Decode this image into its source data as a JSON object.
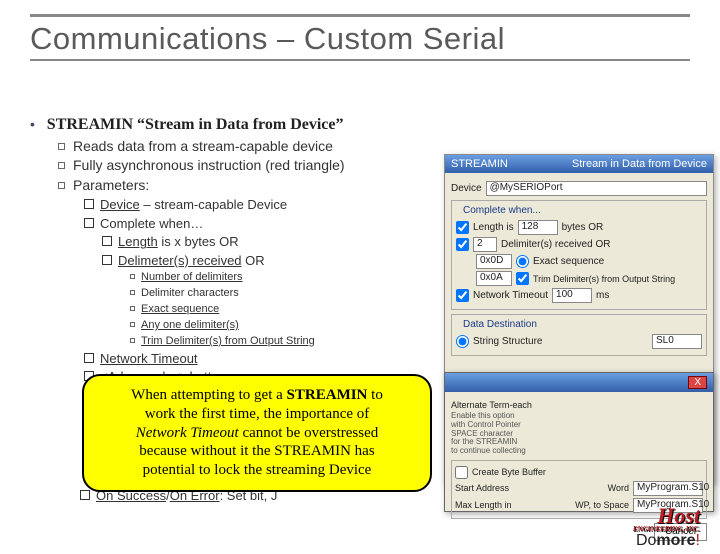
{
  "title": "Communications – Custom Serial",
  "bullet_main_prefix": "STREAMIN ",
  "bullet_main_quote": "“Stream in Data from Device”",
  "sub": {
    "a": "Reads data from a stream-capable device",
    "b": "Fully asynchronous instruction (red triangle)",
    "c": "Parameters:"
  },
  "params": {
    "device_u": "Device",
    "device_rest": " – stream-capable Device",
    "complete": "Complete when…",
    "length_u": "Length",
    "length_rest": " is x bytes OR",
    "delim_u": "Delimeter(s) received",
    "delim_rest": " OR"
  },
  "l4": {
    "a_u": "Number of delimiters",
    "b": "Delimiter characters",
    "c_u": "Exact sequence",
    "d_u": "Any one delimiter(s)",
    "e_u": "Trim Delimiter(s) from Output String"
  },
  "params2": {
    "net_u": "Network Timeout",
    "adv_pre": "",
    "adv_u": "<Advanced…>",
    "adv_rest": " button"
  },
  "callout": {
    "l1a": "When attempting to get a ",
    "l1b": "STREAMIN",
    "l1c": " to",
    "l2": "work the first time, the importance of",
    "l3a": "Network Timeout",
    "l3b": " cannot be overstressed",
    "l4": "because without it the STREAMIN has",
    "l5": "potential to lock the streaming Device"
  },
  "behind": {
    "u1": "On Success",
    "sep": "/",
    "u2": "On Error",
    "rest": ": Set bit, J"
  },
  "dialog": {
    "title_left": "STREAMIN",
    "title_right": "Stream in Data from Device",
    "device_label": "Device",
    "device_value": "@MySERIOPort",
    "complete_group": "Complete when...",
    "length_label": "Length is",
    "length_value": "128",
    "length_unit": "bytes OR",
    "delim_count": "2",
    "delim_label": "Delimiter(s) received OR",
    "hex1": "0x0D",
    "hex2": "0x0A",
    "exact": "Exact sequence",
    "trim": "Trim Delimiter(s) from Output String",
    "net_label": "Network Timeout",
    "net_value": "100",
    "net_unit": "ms",
    "dest_group": "Data Destination",
    "dest_opt": "String Structure",
    "dest_val": "SL0",
    "t1a": "Create Byte Buffer",
    "t2l": "Start Address",
    "t2r": "Word",
    "t3l": "Max Length in",
    "t3r": "WP, to Space",
    "t2v": "MyProgram.S10",
    "t3v": "MyProgram.S10",
    "cancel": "Cancel"
  },
  "sub_dialog": {
    "text1": "Alternate Term-each",
    "text2": "Enable this option",
    "text3": "with Control Pointer",
    "text4": "SPACE character",
    "text5": "for the STREAMIN",
    "text6": "to continue collecting"
  },
  "logo": {
    "host": "Host",
    "host_sub": "ENGINEERING, INC.",
    "domore_a": "Do",
    "domore_b": "more"
  }
}
